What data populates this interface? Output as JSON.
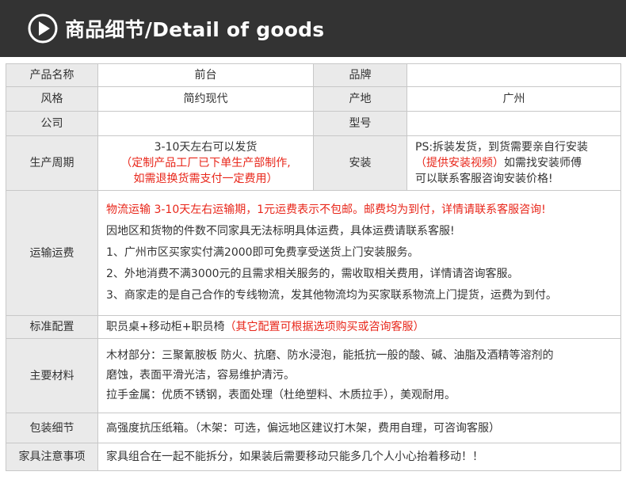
{
  "header": {
    "title": "商品细节/Detail of goods"
  },
  "basic": {
    "name_label": "产品名称",
    "name_value": "前台",
    "brand_label": "品牌",
    "brand_value": "",
    "style_label": "风格",
    "style_value": "简约现代",
    "origin_label": "产地",
    "origin_value": "广州",
    "company_label": "公司",
    "company_value": "",
    "model_label": "型号",
    "model_value": ""
  },
  "production": {
    "label": "生产周期",
    "line1": "3-10天左右可以发货",
    "line2": "（定制产品工厂已下单生产部制作,",
    "line3": "如需退换货需支付一定费用）"
  },
  "install": {
    "label": "安装",
    "line1": "PS:拆装发货，到货需要亲自行安装",
    "line2_red": "（提供安装视频）",
    "line2_rest": "如需找安装师傅",
    "line3": "可以联系客服咨询安装价格!"
  },
  "shipping": {
    "label": "运输运费",
    "notice": "物流运输 3-10天左右运输期，1元运费表示不包邮。邮费均为到付，详情请联系客服咨询!",
    "lines": [
      "因地区和货物的件数不同家具无法标明具体运费，具体运费请联系客服!",
      "1、广州市区买家实付满2000即可免费享受送货上门安装服务。",
      "2、外地消费不满3000元的且需求相关服务的，需收取相关费用，详情请咨询客服。",
      "3、商家走的是自己合作的专线物流，发其他物流均为买家联系物流上门提货，运费为到付。"
    ]
  },
  "config": {
    "label": "标准配置",
    "text": "职员桌+移动柜+职员椅",
    "note": "（其它配置可根据选项购买或咨询客服）"
  },
  "materials": {
    "label": "主要材料",
    "wood_line1": "木材部分：三聚氰胺板 防火、抗磨、防水浸泡，能抵抗一般的酸、碱、油脂及酒精等溶剂的",
    "wood_line2": "磨蚀，表面平滑光洁，容易维护清污。",
    "metal_line": "拉手金属：优质不锈钢，表面处理（杜绝塑料、木质拉手），美观耐用。"
  },
  "packaging": {
    "label": "包装细节",
    "text": "高强度抗压纸箱。（木架：可选，偏远地区建议打木架，费用自理，可咨询客服）"
  },
  "caution": {
    "label": "家具注意事项",
    "text": "家具组合在一起不能拆分，如果装后需要移动只能多几个人小心抬着移动！！"
  },
  "colors": {
    "header_bg": "#333333",
    "label_bg": "#eaeaea",
    "border": "#c8c8c8",
    "accent_red": "#e8261a"
  },
  "icons": {
    "header": "play-icon"
  }
}
